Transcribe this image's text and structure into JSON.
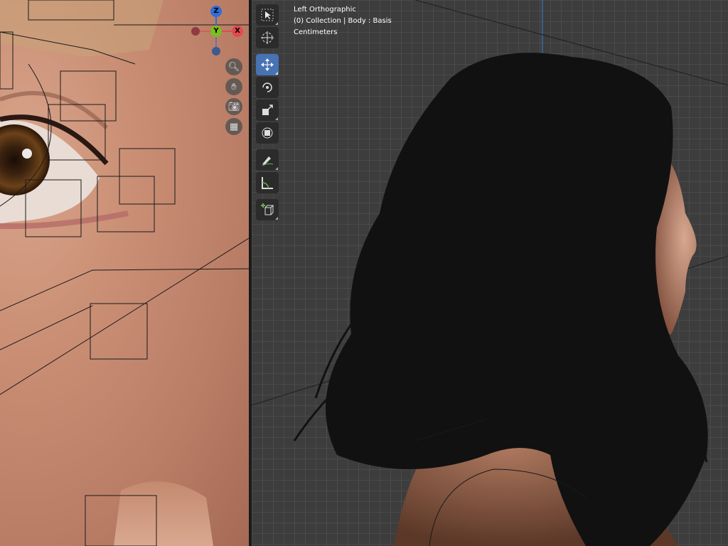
{
  "left_viewport": {
    "gizmo": {
      "z_label": "Z",
      "y_label": "Y",
      "x_label": "X",
      "colors": {
        "z": "#2f6dd6",
        "y": "#7bbf1f",
        "x": "#e34850"
      }
    },
    "nav_buttons": [
      "zoom-icon",
      "hand-pan-icon",
      "camera-icon",
      "grid-ortho-icon"
    ]
  },
  "toolbar": {
    "tools": [
      {
        "name": "select-box-icon",
        "active": false
      },
      {
        "name": "cursor-icon",
        "active": false
      },
      {
        "name": "move-icon",
        "active": true
      },
      {
        "name": "rotate-icon",
        "active": false
      },
      {
        "name": "scale-icon",
        "active": false
      },
      {
        "name": "transform-icon",
        "active": false
      },
      {
        "name": "annotate-icon",
        "active": false
      },
      {
        "name": "measure-icon",
        "active": false
      },
      {
        "name": "add-cube-icon",
        "active": false
      }
    ]
  },
  "viewport_info": {
    "view": "Left Orthographic",
    "collection": "(0) Collection | Body : Basis",
    "units": "Centimeters"
  },
  "colors": {
    "accent": "#4772b3",
    "panel": "#2b2b2b",
    "grid_bg": "#3d3d3d"
  }
}
